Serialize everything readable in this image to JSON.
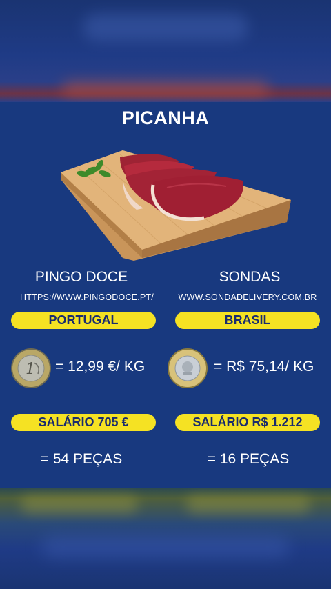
{
  "title": "PICANHA",
  "left": {
    "store": "PINGO DOCE",
    "url": "HTTPS://WWW.PINGODOCE.PT/",
    "country": "PORTUGAL",
    "price": "= 12,99 €/ KG",
    "salary": "SALÁRIO 705 €",
    "pieces": "= 54 PEÇAS"
  },
  "right": {
    "store": "SONDAS",
    "url": "WWW.SONDADELIVERY.COM.BR",
    "country": "BRASIL",
    "price": "= R$ 75,14/ KG",
    "salary": "SALÁRIO R$ 1.212",
    "pieces": "= 16 PEÇAS"
  },
  "colors": {
    "background": "#18397f",
    "pill": "#f5e223",
    "pill_text": "#1a2c6e"
  },
  "icons": [
    "meat-on-board-image",
    "euro-coin-icon",
    "real-coin-icon"
  ]
}
